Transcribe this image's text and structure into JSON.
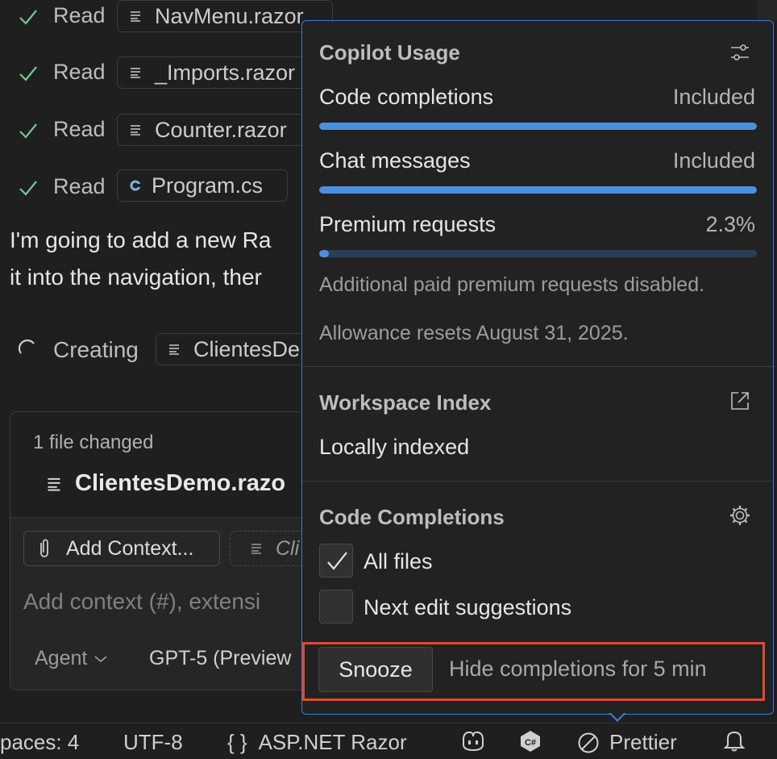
{
  "chat": {
    "read_rows": [
      {
        "verb": "Read",
        "file": "NavMenu.razor",
        "icon": "document-icon"
      },
      {
        "verb": "Read",
        "file": "_Imports.razor",
        "icon": "document-icon"
      },
      {
        "verb": "Read",
        "file": "Counter.razor",
        "icon": "document-icon"
      },
      {
        "verb": "Read",
        "file": "Program.cs",
        "icon": "csharp-file-icon"
      }
    ],
    "message_line1": "I'm going to add a new Ra",
    "message_line2": "it into the navigation, ther",
    "creating_label": "Creating",
    "creating_file": "ClientesDe",
    "changes_count": "1 file changed",
    "changed_file": "ClientesDemo.razo",
    "add_context_label": "Add Context...",
    "context_pill_label": "Cli",
    "input_placeholder": "Add context (#), extensi",
    "agent_label": "Agent",
    "model_label": "GPT-5 (Preview"
  },
  "popup": {
    "usage_title": "Copilot Usage",
    "usage_rows": [
      {
        "label": "Code completions",
        "value": "Included",
        "fill_fraction": 1.0
      },
      {
        "label": "Chat messages",
        "value": "Included",
        "fill_fraction": 1.0
      },
      {
        "label": "Premium requests",
        "value": "2.3%",
        "fill_fraction": 0.023
      }
    ],
    "note_disabled": "Additional paid premium requests disabled.",
    "note_reset": "Allowance resets August 31, 2025.",
    "index_title": "Workspace Index",
    "index_status": "Locally indexed",
    "completions_title": "Code Completions",
    "checkboxes": [
      {
        "label": "All files",
        "checked": true
      },
      {
        "label": "Next edit suggestions",
        "checked": false
      }
    ],
    "snooze_label": "Snooze",
    "snooze_desc": "Hide completions for 5 min"
  },
  "statusbar": {
    "spaces": "paces: 4",
    "encoding": "UTF-8",
    "language_braces": "{ }",
    "language": "ASP.NET Razor",
    "csharp_badge": "C#",
    "prettier": "Prettier"
  },
  "colors": {
    "accent": "#3b7bd8",
    "highlight": "#e04a2f",
    "bar_track": "#2c3e55",
    "bar_fill": "#4b8fe0",
    "check_green": "#73c991"
  }
}
